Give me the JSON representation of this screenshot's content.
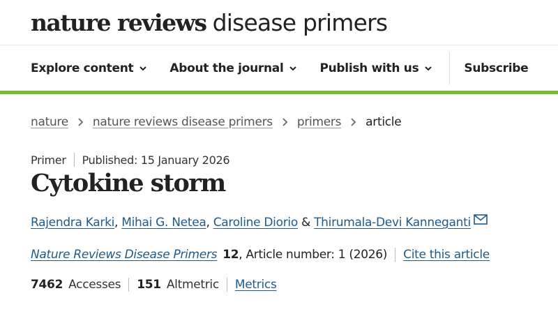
{
  "header": {
    "logo_strong": "nature reviews",
    "logo_light": "disease primers"
  },
  "nav": {
    "explore": "Explore content",
    "about": "About the journal",
    "publish": "Publish with us",
    "subscribe": "Subscribe"
  },
  "breadcrumb": {
    "items": [
      "nature",
      "nature reviews disease primers",
      "primers"
    ],
    "current": "article"
  },
  "article": {
    "type": "Primer",
    "published": "Published: 15 January 2026",
    "title": "Cytokine storm",
    "authors": [
      "Rajendra Karki",
      "Mihai G. Netea",
      "Caroline Diorio",
      "Thirumala-Devi Kanneganti"
    ],
    "author_sep": ", ",
    "author_and": " & ",
    "journal": "Nature Reviews Disease Primers",
    "volume": "12",
    "article_number": ", Article number: 1 (2026)",
    "cite": "Cite this article"
  },
  "metrics": {
    "accesses_count": "7462",
    "accesses_label": "Accesses",
    "altmetric_count": "151",
    "altmetric_label": "Altmetric",
    "metrics_link": "Metrics"
  },
  "colors": {
    "accent_bar": "#7bbc32",
    "link": "#1f5a8a"
  },
  "icons": [
    "chevron-down-icon",
    "chevron-right-icon",
    "mail-icon"
  ]
}
